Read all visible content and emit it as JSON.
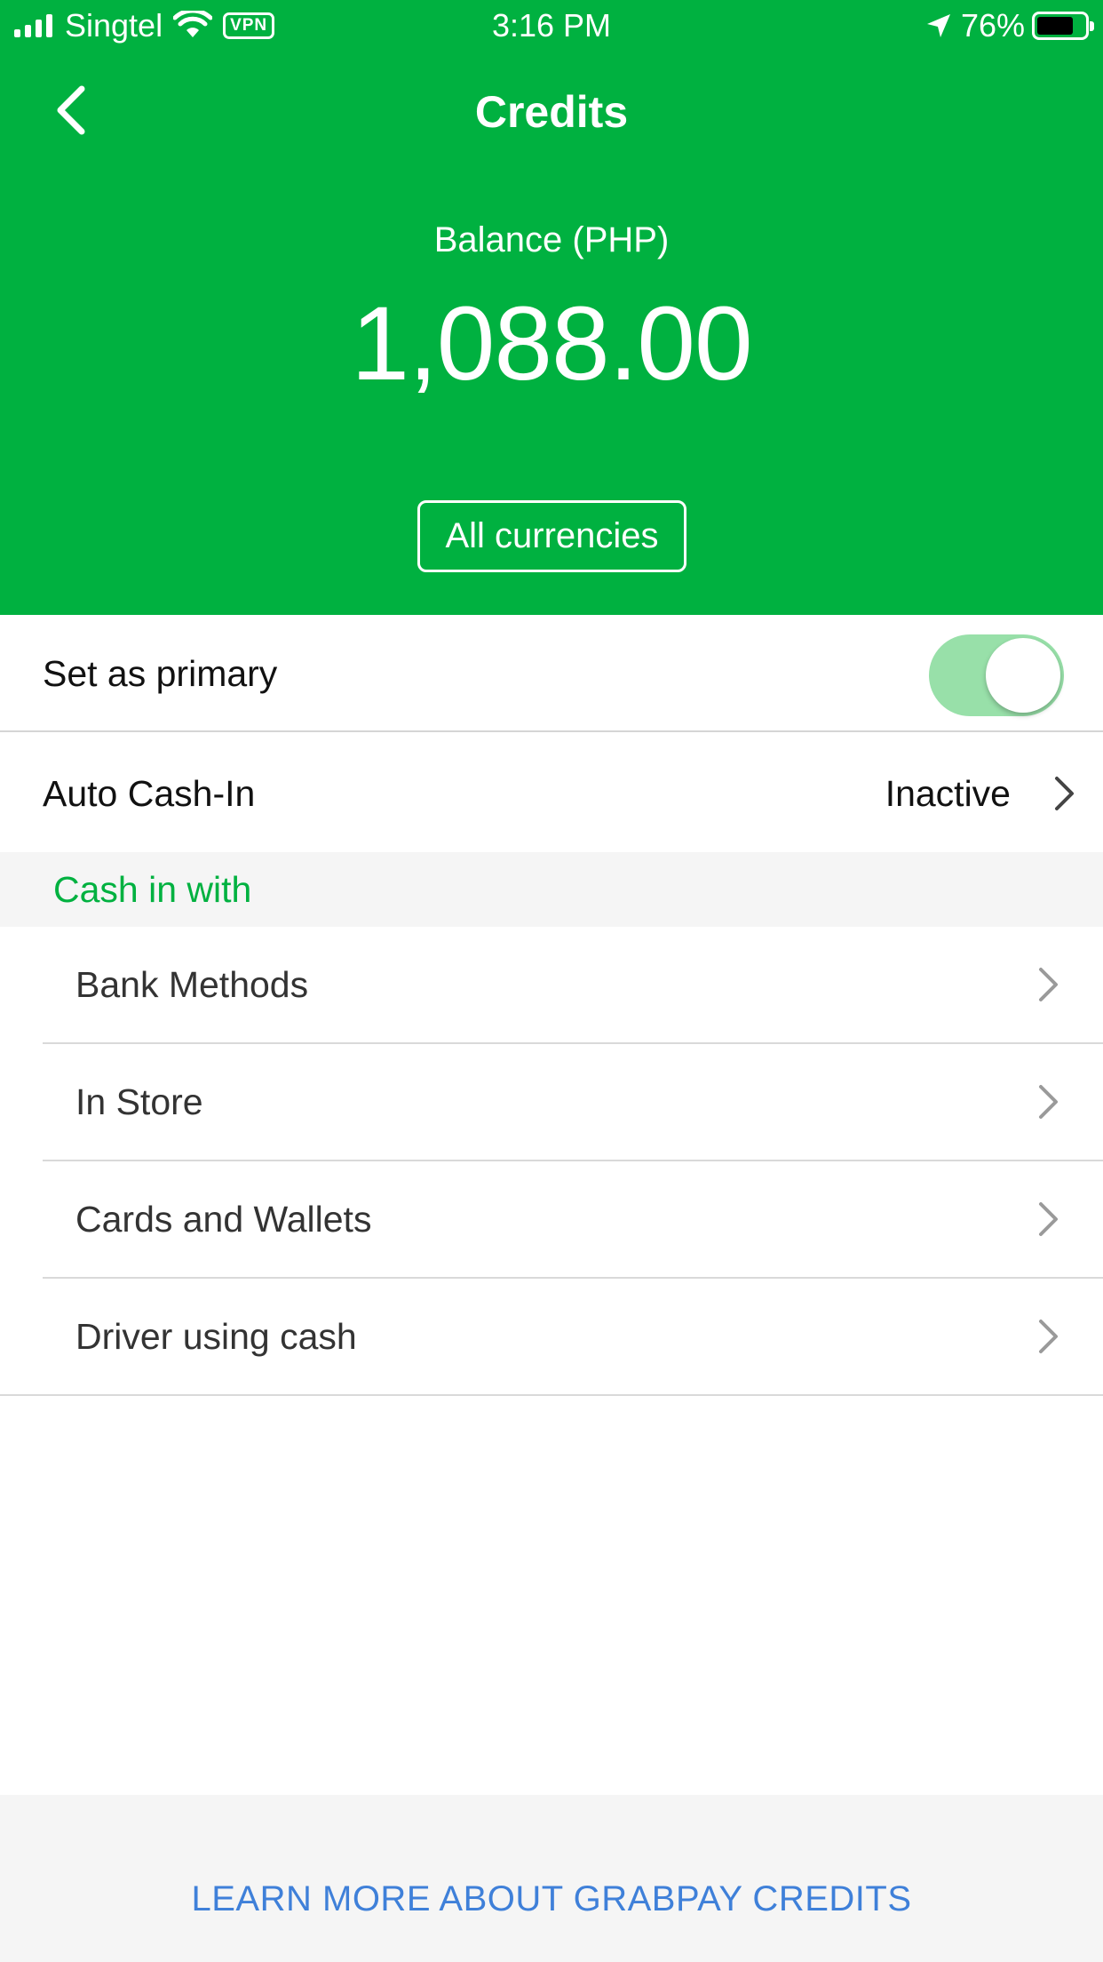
{
  "status_bar": {
    "carrier": "Singtel",
    "vpn": "VPN",
    "time": "3:16 PM",
    "battery_percent": "76%",
    "battery_level": 0.76
  },
  "header": {
    "title": "Credits",
    "balance_label": "Balance (PHP)",
    "balance_value": "1,088.00",
    "currencies_button": "All currencies"
  },
  "settings": {
    "primary_label": "Set as primary",
    "primary_enabled": true,
    "auto_cash_in_label": "Auto Cash-In",
    "auto_cash_in_status": "Inactive"
  },
  "cash_in": {
    "section_title": "Cash in with",
    "methods": [
      {
        "label": "Bank Methods"
      },
      {
        "label": "In Store"
      },
      {
        "label": "Cards and Wallets"
      },
      {
        "label": "Driver using cash"
      }
    ]
  },
  "footer": {
    "link_label": "LEARN MORE ABOUT GRABPAY CREDITS"
  },
  "colors": {
    "brand_green": "#00b140",
    "toggle_on_track": "#98e0a9",
    "link_blue": "#3f80d9"
  }
}
